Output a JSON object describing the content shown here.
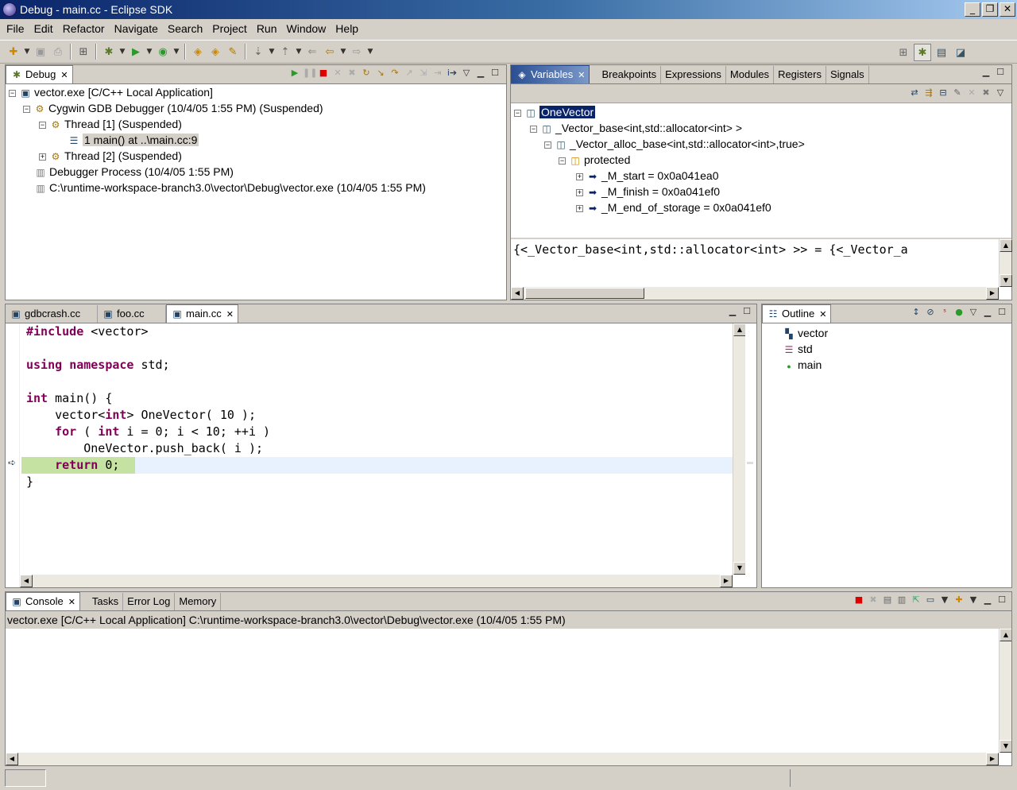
{
  "window": {
    "title": "Debug - main.cc - Eclipse SDK"
  },
  "menu": [
    "File",
    "Edit",
    "Refactor",
    "Navigate",
    "Search",
    "Project",
    "Run",
    "Window",
    "Help"
  ],
  "debug_view": {
    "tab": "Debug",
    "tree": [
      {
        "label": "vector.exe [C/C++ Local Application]"
      },
      {
        "label": "Cygwin GDB Debugger (10/4/05 1:55 PM) (Suspended)"
      },
      {
        "label": "Thread [1] (Suspended)"
      },
      {
        "label": "1 main() at ..\\main.cc:9"
      },
      {
        "label": "Thread [2] (Suspended)"
      },
      {
        "label": "Debugger Process (10/4/05 1:55 PM)"
      },
      {
        "label": "C:\\runtime-workspace-branch3.0\\vector\\Debug\\vector.exe (10/4/05 1:55 PM)"
      }
    ]
  },
  "variables_view": {
    "tabs": [
      "Variables",
      "Breakpoints",
      "Expressions",
      "Modules",
      "Registers",
      "Signals"
    ],
    "tree": [
      {
        "label": "OneVector"
      },
      {
        "label": "_Vector_base<int,std::allocator<int> >"
      },
      {
        "label": "_Vector_alloc_base<int,std::allocator<int>,true>"
      },
      {
        "label": "protected"
      },
      {
        "label": "_M_start = 0x0a041ea0"
      },
      {
        "label": "_M_finish = 0x0a041ef0"
      },
      {
        "label": "_M_end_of_storage = 0x0a041ef0"
      }
    ],
    "detail": "{<_Vector_base<int,std::allocator<int> >> = {<_Vector_a"
  },
  "editor": {
    "tabs": [
      "gdbcrash.cc",
      "foo.cc",
      "main.cc"
    ],
    "lines": [
      [
        {
          "t": "#include",
          "k": true
        },
        {
          "t": " <vector>",
          "k": false
        }
      ],
      [],
      [
        {
          "t": "using",
          "k": true
        },
        {
          "t": " ",
          "k": false
        },
        {
          "t": "namespace",
          "k": true
        },
        {
          "t": " std;",
          "k": false
        }
      ],
      [],
      [
        {
          "t": "int",
          "k": true
        },
        {
          "t": " main() {",
          "k": false
        }
      ],
      [
        {
          "t": "    vector<",
          "k": false
        },
        {
          "t": "int",
          "k": true
        },
        {
          "t": "> OneVector( 10 );",
          "k": false
        }
      ],
      [
        {
          "t": "    ",
          "k": false
        },
        {
          "t": "for",
          "k": true
        },
        {
          "t": " ( ",
          "k": false
        },
        {
          "t": "int",
          "k": true
        },
        {
          "t": " i = 0; i < 10; ++i )",
          "k": false
        }
      ],
      [
        {
          "t": "        OneVector.push_back( i );",
          "k": false
        }
      ],
      [
        {
          "t": "    ",
          "k": false
        },
        {
          "t": "return",
          "k": true
        },
        {
          "t": " 0;",
          "k": false
        }
      ],
      [
        {
          "t": "}",
          "k": false
        }
      ]
    ]
  },
  "outline_view": {
    "tab": "Outline",
    "items": [
      {
        "label": "vector"
      },
      {
        "label": "std"
      },
      {
        "label": "main"
      }
    ]
  },
  "console_view": {
    "tabs": [
      "Console",
      "Tasks",
      "Error Log",
      "Memory"
    ],
    "process_label": "vector.exe [C/C++ Local Application] C:\\runtime-workspace-branch3.0\\vector\\Debug\\vector.exe (10/4/05 1:55 PM)"
  }
}
